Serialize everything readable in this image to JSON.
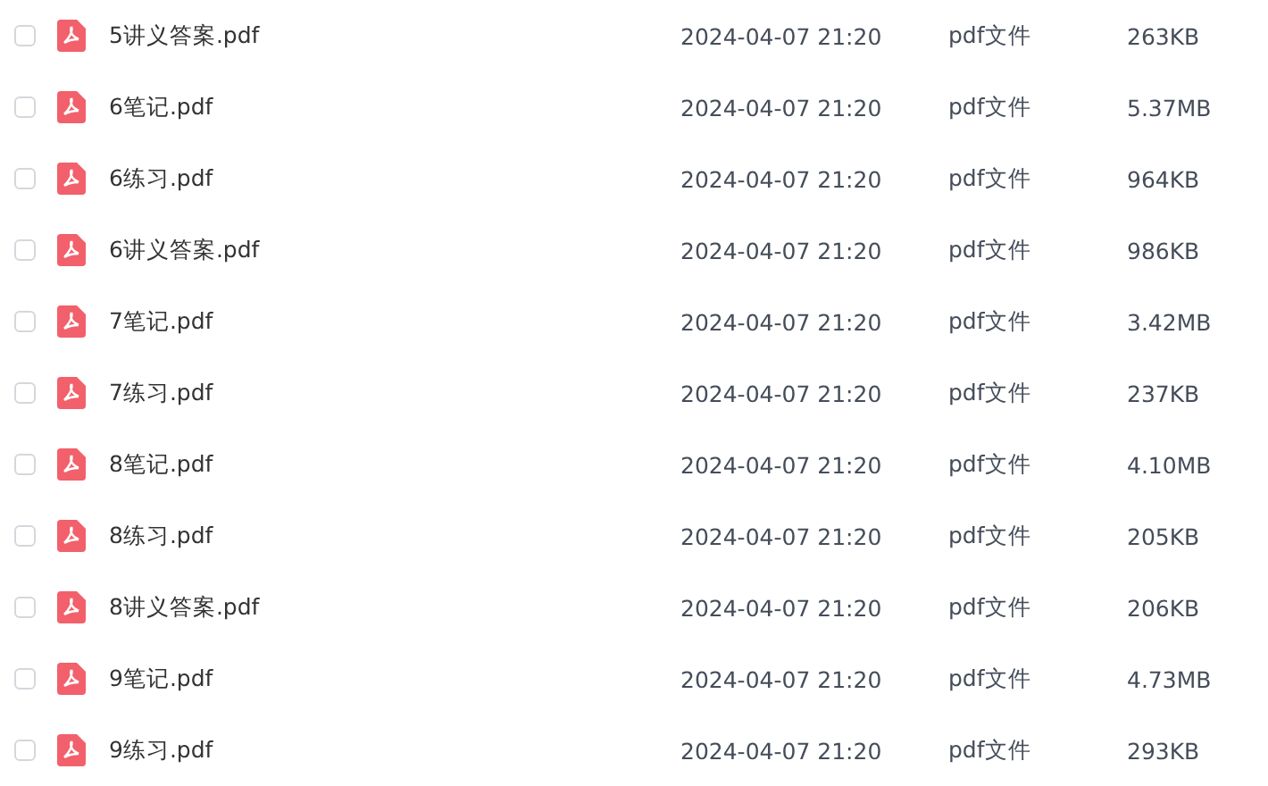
{
  "files": [
    {
      "name": "5讲义答案.pdf",
      "modified": "2024-04-07 21:20",
      "type": "pdf文件",
      "size": "263KB",
      "checked": false
    },
    {
      "name": "6笔记.pdf",
      "modified": "2024-04-07 21:20",
      "type": "pdf文件",
      "size": "5.37MB",
      "checked": false
    },
    {
      "name": "6练习.pdf",
      "modified": "2024-04-07 21:20",
      "type": "pdf文件",
      "size": "964KB",
      "checked": false
    },
    {
      "name": "6讲义答案.pdf",
      "modified": "2024-04-07 21:20",
      "type": "pdf文件",
      "size": "986KB",
      "checked": false
    },
    {
      "name": "7笔记.pdf",
      "modified": "2024-04-07 21:20",
      "type": "pdf文件",
      "size": "3.42MB",
      "checked": false
    },
    {
      "name": "7练习.pdf",
      "modified": "2024-04-07 21:20",
      "type": "pdf文件",
      "size": "237KB",
      "checked": false
    },
    {
      "name": "8笔记.pdf",
      "modified": "2024-04-07 21:20",
      "type": "pdf文件",
      "size": "4.10MB",
      "checked": false
    },
    {
      "name": "8练习.pdf",
      "modified": "2024-04-07 21:20",
      "type": "pdf文件",
      "size": "205KB",
      "checked": false
    },
    {
      "name": "8讲义答案.pdf",
      "modified": "2024-04-07 21:20",
      "type": "pdf文件",
      "size": "206KB",
      "checked": false
    },
    {
      "name": "9笔记.pdf",
      "modified": "2024-04-07 21:20",
      "type": "pdf文件",
      "size": "4.73MB",
      "checked": false
    },
    {
      "name": "9练习.pdf",
      "modified": "2024-04-07 21:20",
      "type": "pdf文件",
      "size": "293KB",
      "checked": false
    }
  ]
}
